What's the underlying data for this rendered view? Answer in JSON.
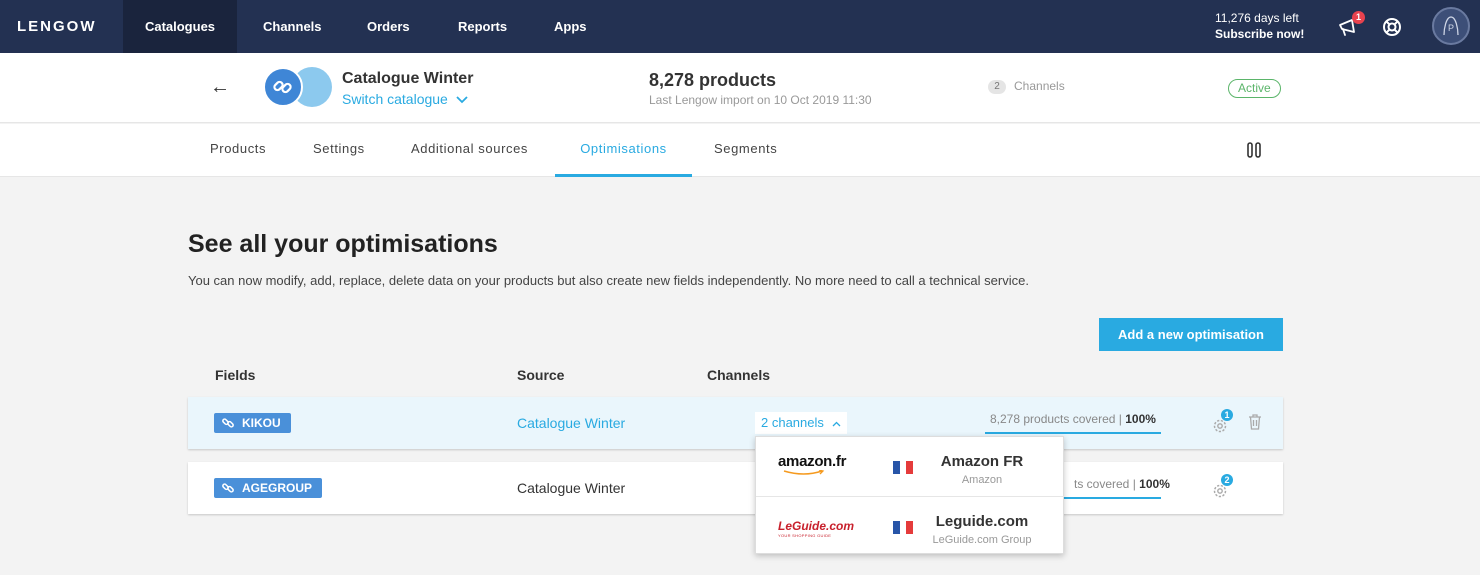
{
  "nav": {
    "logo": "LENGOW",
    "items": [
      "Catalogues",
      "Channels",
      "Orders",
      "Reports",
      "Apps"
    ],
    "active": "Catalogues",
    "subscription_days": "11,276 days left",
    "subscription_cta": "Subscribe now!",
    "notification_count": "1",
    "icons": [
      "megaphone-icon",
      "lifebuoy-icon",
      "avatar-icon"
    ]
  },
  "catalogue": {
    "name": "Catalogue Winter",
    "switch_label": "Switch catalogue",
    "product_count": "8,278 products",
    "last_import": "Last Lengow import on 10 Oct 2019 11:30",
    "channels_count": "2",
    "channels_label": "Channels",
    "status": "Active"
  },
  "tabs": [
    {
      "label": "Products"
    },
    {
      "label": "Settings"
    },
    {
      "label": "Additional sources"
    },
    {
      "label": "Optimisations",
      "active": true
    },
    {
      "label": "Segments"
    }
  ],
  "main": {
    "title": "See all your optimisations",
    "description": "You can now modify, add, replace, delete data on your products but also create new fields independently. No more need to call a technical service.",
    "add_button": "Add a new optimisation",
    "columns": [
      "Fields",
      "Source",
      "Channels"
    ]
  },
  "rows": [
    {
      "field": "KIKOU",
      "source": "Catalogue Winter",
      "channels": "2 channels",
      "covered": "8,278 products covered",
      "sep": "|",
      "pct": "100%",
      "gear_badge": "1"
    },
    {
      "field": "AGEGROUP",
      "source": "Catalogue Winter",
      "covered": "ts covered",
      "sep": "|",
      "pct": "100%",
      "gear_badge": "2"
    }
  ],
  "dropdown": [
    {
      "logo": "amazon.fr",
      "name": "Amazon FR",
      "group": "Amazon",
      "flag": "fr"
    },
    {
      "logo": "LeGuide.com",
      "logo_tagline": "YOUR SHOPPING GUIDE",
      "name": "Leguide.com",
      "group": "LeGuide.com Group",
      "flag": "fr"
    }
  ],
  "colors": {
    "nav_bg": "#233152",
    "accent": "#29aae1",
    "active_green": "#5bb56a",
    "tag_blue": "#4a90d9",
    "badge_red": "#e8424e"
  }
}
